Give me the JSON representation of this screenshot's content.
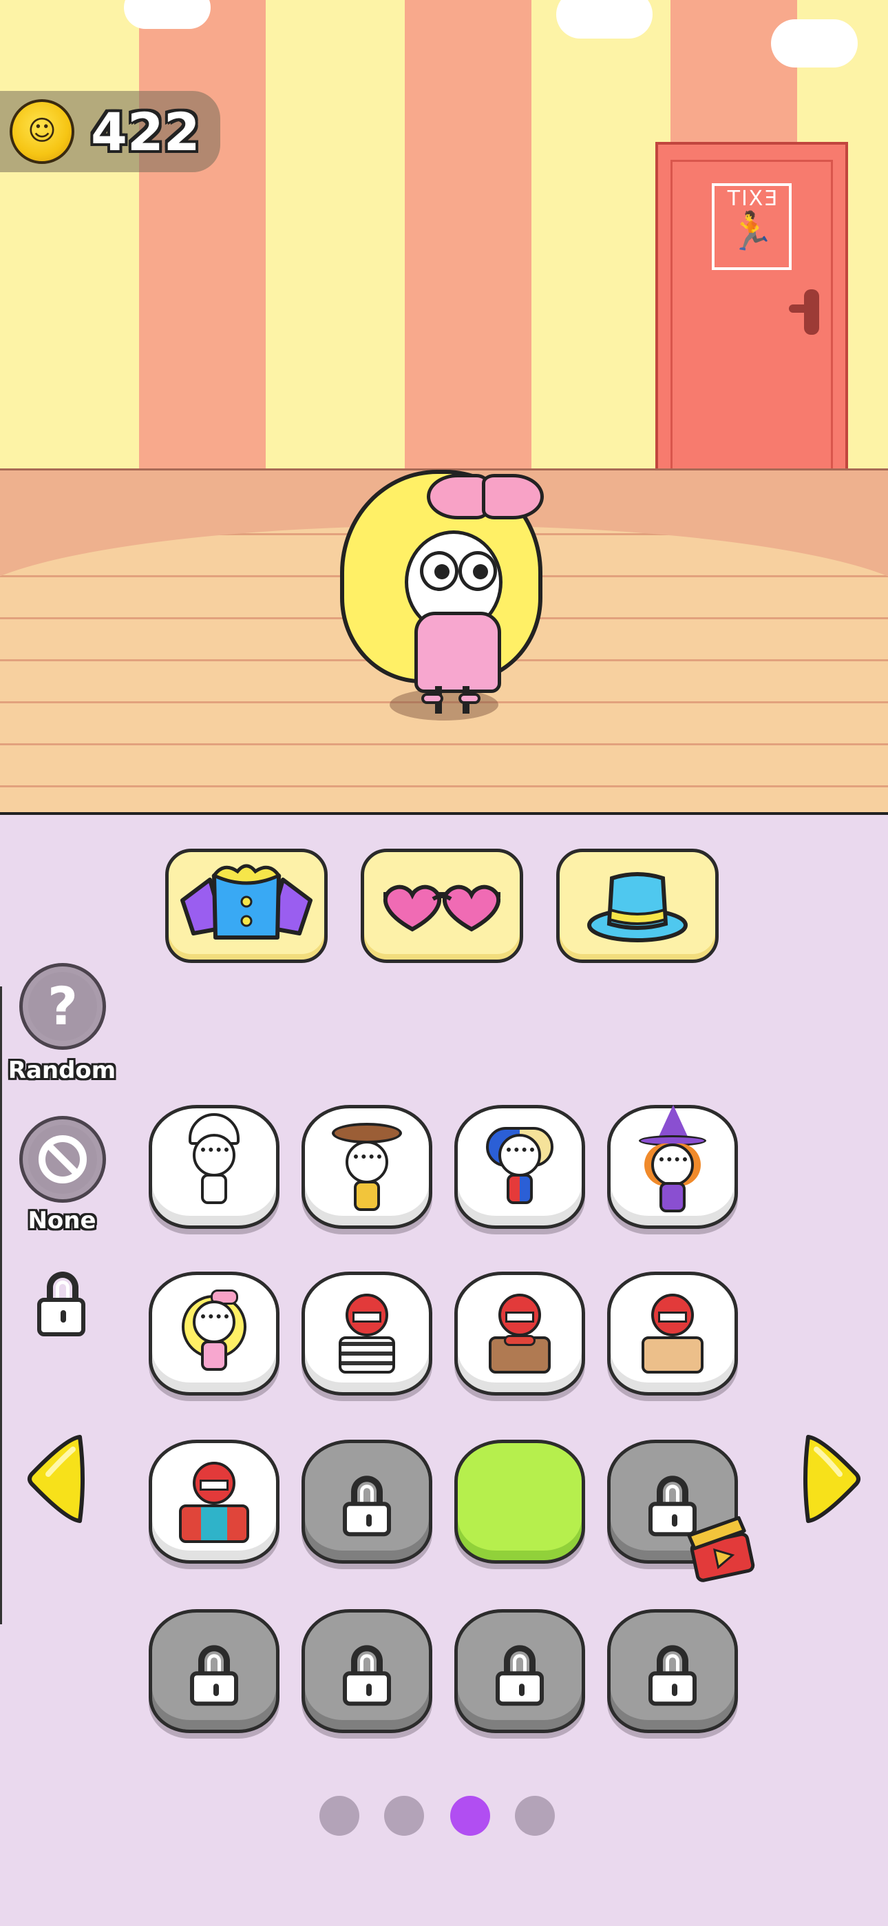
{
  "hud": {
    "coins": "422",
    "coin_icon": "coin-icon"
  },
  "scene": {
    "exit_sign_text": "EXIT",
    "exit_icon": "running-man-icon"
  },
  "categories": [
    {
      "name": "outfit",
      "icon": "shirt-icon",
      "color": "#39a9f4"
    },
    {
      "name": "glasses",
      "icon": "heart-glasses-icon",
      "color": "#f06bb4"
    },
    {
      "name": "hat",
      "icon": "top-hat-icon",
      "color": "#4fc8ef"
    }
  ],
  "side": {
    "random_label": "Random",
    "none_label": "None"
  },
  "grid": {
    "rows": [
      [
        "chef",
        "cowboy",
        "harley",
        "witch"
      ],
      [
        "princess",
        "mime",
        "monster-scarf",
        "monster-jacket"
      ],
      [
        "monster-clown",
        "locked",
        "green-selected",
        "locked-ad"
      ],
      [
        "locked",
        "locked",
        "locked",
        "locked"
      ]
    ]
  },
  "pagination": {
    "pages": 4,
    "current": 3
  },
  "colors": {
    "panel_bg": "#ead9ee",
    "active_dot": "#b14ef2",
    "inactive_dot": "#b3a3b8",
    "arrow_yellow": "#f7e11a"
  }
}
